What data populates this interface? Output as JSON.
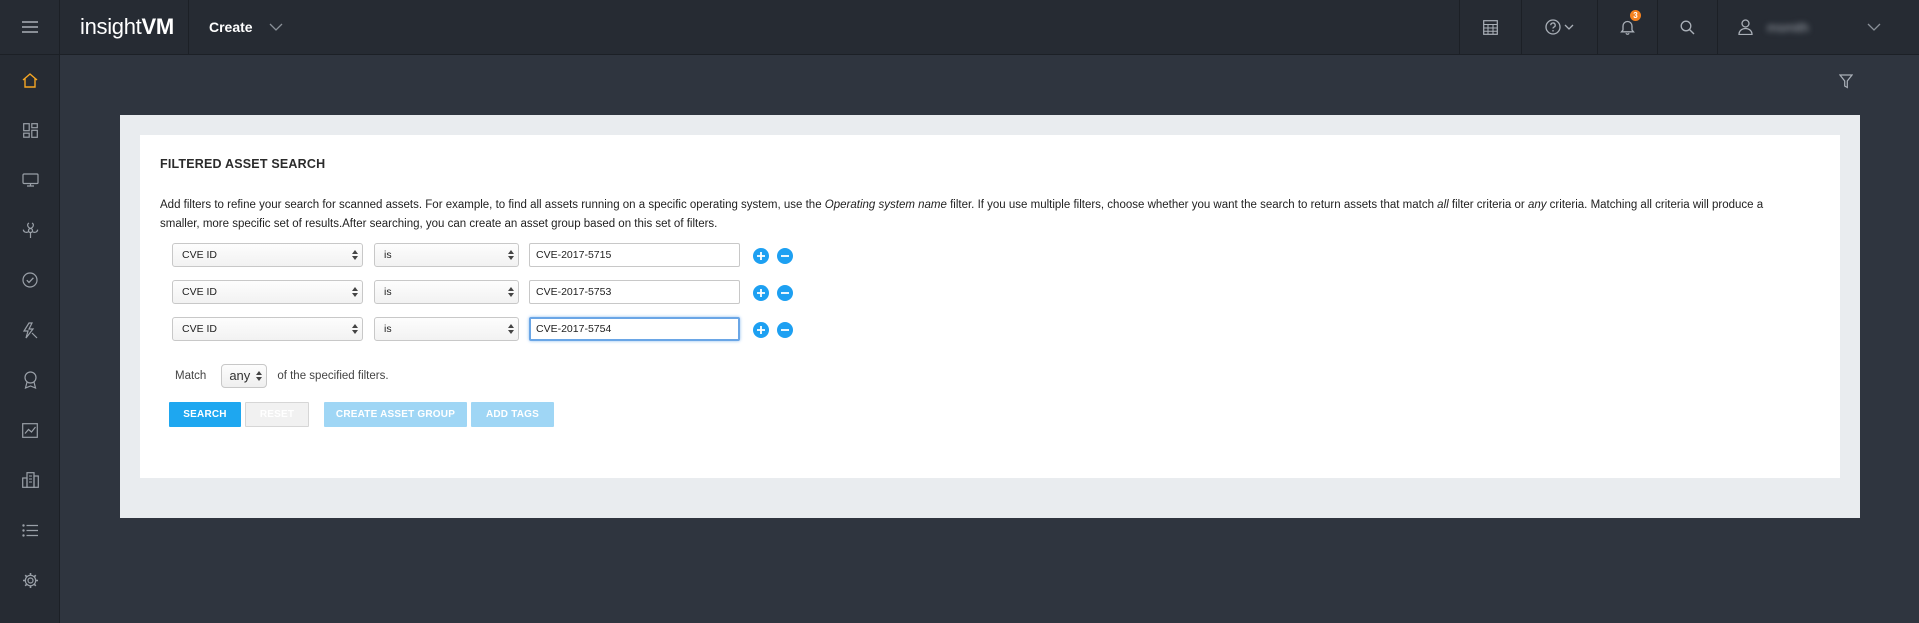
{
  "header": {
    "brand_light": "insight",
    "brand_bold": "VM",
    "create_label": "Create",
    "notification_count": "3",
    "username": "msmith"
  },
  "page": {
    "title": "FILTERED ASSET SEARCH",
    "description": {
      "part1": "Add filters to refine your search for scanned assets. For example, to find all assets running on a specific operating system, use the ",
      "em1": "Operating system name",
      "part2": "  filter. If you use multiple filters, choose whether you want the search to return assets that match ",
      "em2": "all",
      "part3": "  filter criteria or ",
      "em3": "any",
      "part4": "  criteria. Matching all criteria will produce a smaller, more specific set of results.After searching, you can create an asset group based on this set of filters."
    },
    "filters": [
      {
        "field": "CVE ID",
        "operator": "is",
        "value": "CVE-2017-5715"
      },
      {
        "field": "CVE ID",
        "operator": "is",
        "value": "CVE-2017-5753"
      },
      {
        "field": "CVE ID",
        "operator": "is",
        "value": "CVE-2017-5754"
      }
    ],
    "match": {
      "prefix": "Match",
      "value": "any",
      "suffix": "of the specified filters."
    },
    "buttons": {
      "search": "SEARCH",
      "reset": "RESET",
      "create_group": "CREATE ASSET GROUP",
      "add_tags": "ADD TAGS"
    }
  },
  "colors": {
    "accent": "#1ea7f0",
    "home_active": "#f5a623",
    "badge": "#f5821f"
  },
  "icons": {
    "rail": [
      "home-icon",
      "dashboard-icon",
      "assets-icon",
      "vulnerabilities-icon",
      "policies-icon",
      "remediation-icon",
      "certification-icon",
      "reports-icon",
      "sites-icon",
      "list-icon",
      "settings-icon"
    ]
  }
}
